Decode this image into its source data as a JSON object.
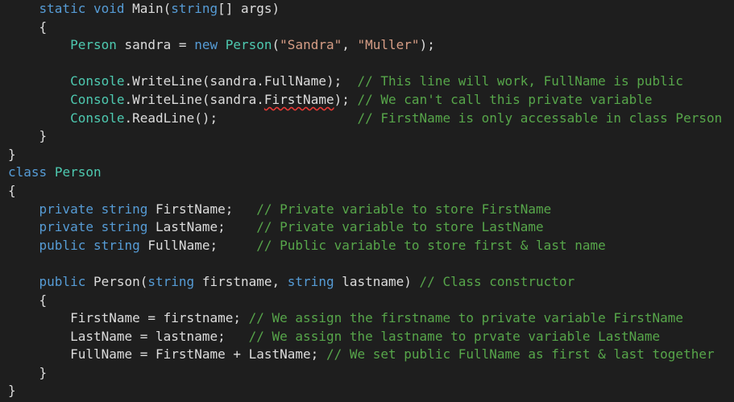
{
  "colors": {
    "background": "#1e1e1e",
    "keyword": "#569cd6",
    "type": "#4ec9b0",
    "string": "#d69d85",
    "comment": "#57a64a",
    "plain": "#dcdcdc",
    "error_squiggle": "#e53935"
  },
  "lines": [
    [
      {
        "t": "    "
      },
      {
        "t": "static",
        "c": "kw"
      },
      {
        "t": " "
      },
      {
        "t": "void",
        "c": "kw"
      },
      {
        "t": " Main("
      },
      {
        "t": "string",
        "c": "kw"
      },
      {
        "t": "[] args)"
      }
    ],
    [
      {
        "t": "    {"
      }
    ],
    [
      {
        "t": "        "
      },
      {
        "t": "Person",
        "c": "type"
      },
      {
        "t": " sandra = "
      },
      {
        "t": "new",
        "c": "kw"
      },
      {
        "t": " "
      },
      {
        "t": "Person",
        "c": "type"
      },
      {
        "t": "("
      },
      {
        "t": "\"Sandra\"",
        "c": "str"
      },
      {
        "t": ", "
      },
      {
        "t": "\"Muller\"",
        "c": "str"
      },
      {
        "t": ");"
      }
    ],
    [
      {
        "t": ""
      }
    ],
    [
      {
        "t": "        "
      },
      {
        "t": "Console",
        "c": "type"
      },
      {
        "t": ".WriteLine(sandra.FullName);  "
      },
      {
        "t": "// This line will work, FullName is public",
        "c": "cmt"
      }
    ],
    [
      {
        "t": "        "
      },
      {
        "t": "Console",
        "c": "type"
      },
      {
        "t": ".WriteLine(sandra."
      },
      {
        "t": "FirstName",
        "c": "err"
      },
      {
        "t": "); "
      },
      {
        "t": "// We can't call this private variable",
        "c": "cmt"
      }
    ],
    [
      {
        "t": "        "
      },
      {
        "t": "Console",
        "c": "type"
      },
      {
        "t": ".ReadLine();                  "
      },
      {
        "t": "// FirstName is only accessable in class Person",
        "c": "cmt"
      }
    ],
    [
      {
        "t": "    }"
      }
    ],
    [
      {
        "t": "}"
      }
    ],
    [
      {
        "t": "class",
        "c": "kw"
      },
      {
        "t": " "
      },
      {
        "t": "Person",
        "c": "type"
      }
    ],
    [
      {
        "t": "{"
      }
    ],
    [
      {
        "t": "    "
      },
      {
        "t": "private",
        "c": "kw"
      },
      {
        "t": " "
      },
      {
        "t": "string",
        "c": "kw"
      },
      {
        "t": " FirstName;   "
      },
      {
        "t": "// Private variable to store FirstName",
        "c": "cmt"
      }
    ],
    [
      {
        "t": "    "
      },
      {
        "t": "private",
        "c": "kw"
      },
      {
        "t": " "
      },
      {
        "t": "string",
        "c": "kw"
      },
      {
        "t": " LastName;    "
      },
      {
        "t": "// Private variable to store LastName",
        "c": "cmt"
      }
    ],
    [
      {
        "t": "    "
      },
      {
        "t": "public",
        "c": "kw"
      },
      {
        "t": " "
      },
      {
        "t": "string",
        "c": "kw"
      },
      {
        "t": " FullName;     "
      },
      {
        "t": "// Public variable to store first & last name",
        "c": "cmt"
      }
    ],
    [
      {
        "t": ""
      }
    ],
    [
      {
        "t": "    "
      },
      {
        "t": "public",
        "c": "kw"
      },
      {
        "t": " Person("
      },
      {
        "t": "string",
        "c": "kw"
      },
      {
        "t": " firstname, "
      },
      {
        "t": "string",
        "c": "kw"
      },
      {
        "t": " lastname) "
      },
      {
        "t": "// Class constructor",
        "c": "cmt"
      }
    ],
    [
      {
        "t": "    {"
      }
    ],
    [
      {
        "t": "        FirstName = firstname; "
      },
      {
        "t": "// We assign the firstname to private variable FirstName",
        "c": "cmt"
      }
    ],
    [
      {
        "t": "        LastName = lastname;   "
      },
      {
        "t": "// We assign the lastname to prvate variable LastName",
        "c": "cmt"
      }
    ],
    [
      {
        "t": "        FullName = FirstName + LastName; "
      },
      {
        "t": "// We set public FullName as first & last together",
        "c": "cmt"
      }
    ],
    [
      {
        "t": "    }"
      }
    ],
    [
      {
        "t": "}"
      }
    ]
  ]
}
